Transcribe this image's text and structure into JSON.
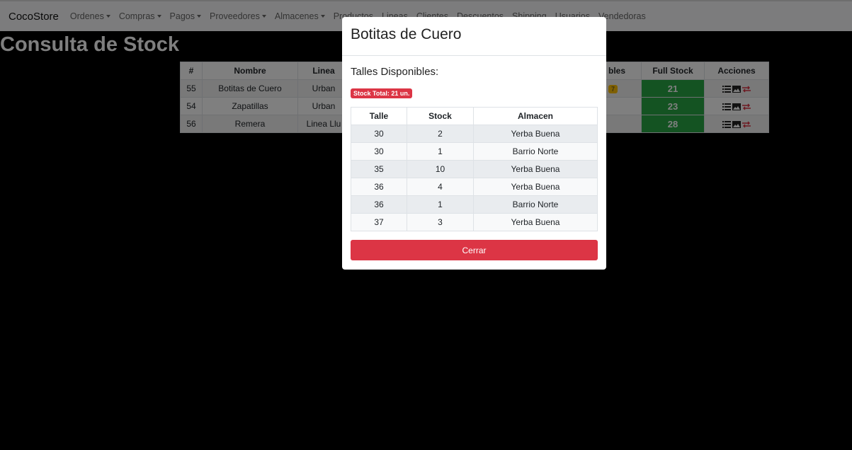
{
  "navbar": {
    "brand": "CocoStore",
    "items": [
      {
        "label": "Ordenes",
        "dropdown": true
      },
      {
        "label": "Compras",
        "dropdown": true
      },
      {
        "label": "Pagos",
        "dropdown": true
      },
      {
        "label": "Proveedores",
        "dropdown": true
      },
      {
        "label": "Almacenes",
        "dropdown": true
      },
      {
        "label": "Productos",
        "dropdown": false
      },
      {
        "label": "Lineas",
        "dropdown": false
      },
      {
        "label": "Clientes",
        "dropdown": false
      },
      {
        "label": "Descuentos",
        "dropdown": false
      },
      {
        "label": "Shipping",
        "dropdown": false
      },
      {
        "label": "Usuarios",
        "dropdown": false
      },
      {
        "label": "Vendedoras",
        "dropdown": false
      }
    ]
  },
  "page": {
    "title": "Consulta de Stock"
  },
  "stock_table": {
    "headers": [
      "#",
      "Nombre",
      "Linea",
      "",
      "bles",
      "Full Stock",
      "Acciones"
    ],
    "rows": [
      {
        "id": "55",
        "name": "Botitas de Cuero",
        "linea": "Urban",
        "badge": "7",
        "full_stock": "21"
      },
      {
        "id": "54",
        "name": "Zapatillas",
        "linea": "Urban",
        "badge": "",
        "full_stock": "23"
      },
      {
        "id": "56",
        "name": "Remera",
        "linea": "Linea Llu",
        "badge": "",
        "full_stock": "28"
      }
    ]
  },
  "modal": {
    "title": "Botitas de Cuero",
    "subtitle": "Talles Disponibles:",
    "total_badge": "Stock Total: 21 un.",
    "headers": [
      "Talle",
      "Stock",
      "Almacen"
    ],
    "rows": [
      [
        "30",
        "2",
        "Yerba Buena"
      ],
      [
        "30",
        "1",
        "Barrio Norte"
      ],
      [
        "35",
        "10",
        "Yerba Buena"
      ],
      [
        "36",
        "4",
        "Yerba Buena"
      ],
      [
        "36",
        "1",
        "Barrio Norte"
      ],
      [
        "37",
        "3",
        "Yerba Buena"
      ]
    ],
    "close_label": "Cerrar"
  },
  "colors": {
    "danger": "#dc3545",
    "success": "#28a745",
    "warning": "#ffc107"
  }
}
